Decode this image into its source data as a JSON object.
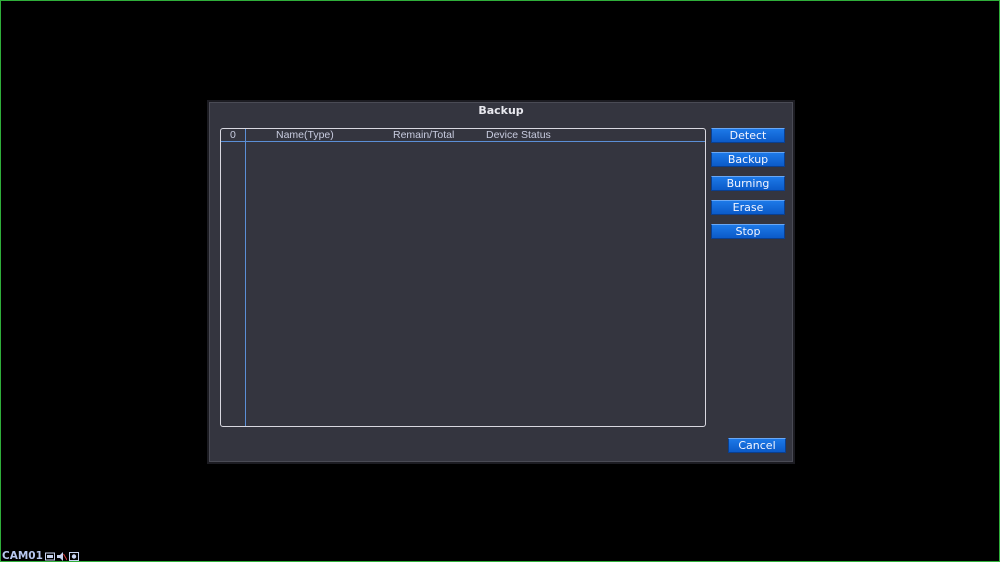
{
  "dialog": {
    "title": "Backup"
  },
  "table": {
    "columns": [
      "0",
      "Name(Type)",
      "Remain/Total",
      "Device Status"
    ],
    "rows": []
  },
  "buttons": {
    "detect": "Detect",
    "backup": "Backup",
    "burning": "Burning",
    "erase": "Erase",
    "stop": "Stop",
    "cancel": "Cancel"
  },
  "status_bar": {
    "camera": "CAM01",
    "icons": [
      "record-icon",
      "audio-muted-icon",
      "motion-icon"
    ]
  },
  "colors": {
    "accent_button": "#1466d6",
    "dialog_bg": "#34353f",
    "divider": "#5b8fd6",
    "screen_border": "#2fae3a"
  }
}
